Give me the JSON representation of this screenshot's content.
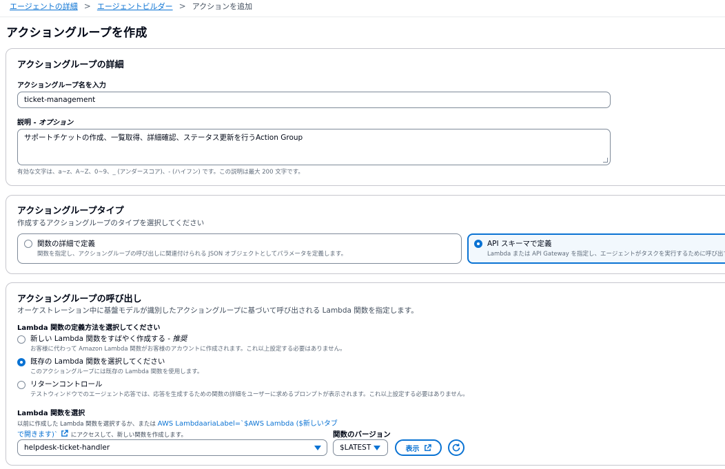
{
  "breadcrumb": {
    "items": [
      "エージェントの詳細",
      "エージェントビルダー"
    ],
    "current": "アクションを追加"
  },
  "page_title": "アクショングループを作成",
  "details": {
    "title": "アクショングループの詳細",
    "name_label": "アクショングループ名を入力",
    "name_value": "ticket-management",
    "desc_label_main": "説明 - ",
    "desc_label_optional": "オプション",
    "desc_value": "サポートチケットの作成、一覧取得、詳細確認、ステータス更新を行うAction Group",
    "hint": "有効な文字は、a~z、A~Z、0~9、_ (アンダースコア)、- (ハイフン) です。この説明は最大 200 文字です。"
  },
  "type": {
    "title": "アクショングループタイプ",
    "subtitle": "作成するアクショングループのタイプを選択してください",
    "options": [
      {
        "label": "関数の詳細で定義",
        "desc": "関数を指定し、アクショングループの呼び出しに関連付けられる JSON オブジェクトとしてパラメータを定義します。"
      },
      {
        "label": "API スキーマで定義",
        "desc": "Lambda または API Gateway を指定し、エージェントがタスクを実行するために呼び出す"
      }
    ]
  },
  "invoke": {
    "title": "アクショングループの呼び出し",
    "subtitle": "オーケストレーション中に基盤モデルが識別したアクショングループに基づいて呼び出される Lambda 関数を指定します。",
    "method_label": "Lambda 関数の定義方法を選択してください",
    "options": [
      {
        "label": "新しい Lambda 関数をすばやく作成する - ",
        "label_em": "推奨",
        "desc": "お客様に代わって Amazon Lambda 関数がお客様のアカウントに作成されます。これ以上設定する必要はありません。"
      },
      {
        "label": "既存の Lambda 関数を選択してください",
        "label_em": "",
        "desc": "このアクショングループには既存の Lambda 関数を使用します。"
      },
      {
        "label": "リターンコントロール",
        "label_em": "",
        "desc": "テストウィンドウでのエージェント応答では、応答を生成するための関数の詳細をユーザーに求めるプロンプトが表示されます。これ以上設定する必要はありません。"
      }
    ],
    "lambda_label": "Lambda 関数を選択",
    "lambda_desc_pre": "以前に作成した Lambda 関数を選択するか、または ",
    "lambda_desc_link": "AWS LambdaariaLabel=`$AWS Lambda ($新しいタブで開きます)`",
    "lambda_desc_post": "にアクセスして、新しい関数を作成します。",
    "lambda_selected": "helpdesk-ticket-handler",
    "version_label": "関数のバージョン",
    "version_selected": "$LATEST",
    "view_button": "表示"
  },
  "colors": {
    "accent": "#0972d3",
    "border": "#7d8998",
    "text": "#000716",
    "muted": "#5f6b7a"
  }
}
